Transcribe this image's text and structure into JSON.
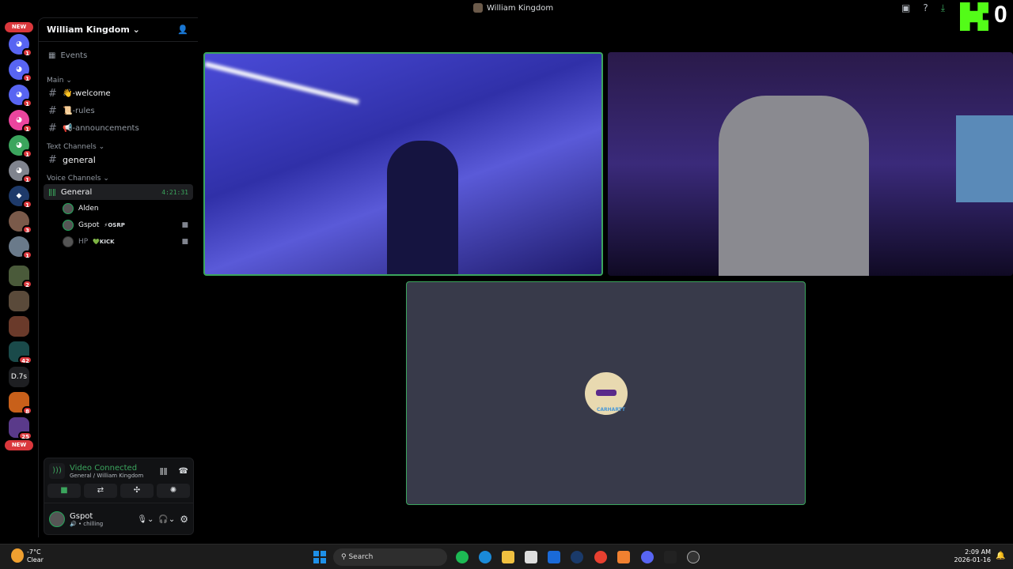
{
  "window": {
    "title": "William Kingdom"
  },
  "kick": {
    "count": "0",
    "color": "#53fc18"
  },
  "rail": {
    "new_top": "NEW",
    "new_bottom": "NEW",
    "dm_badges": [
      "1",
      "1",
      "1",
      "1",
      "1",
      "1",
      "1",
      "3",
      "1",
      "2"
    ],
    "badges_lower": [
      "42",
      "8",
      "25"
    ],
    "text_server": "D.7s"
  },
  "guild": {
    "name": "William Kingdom",
    "events": "Events",
    "categories": {
      "main": "Main",
      "text": "Text Channels",
      "voice": "Voice Channels"
    },
    "channels": {
      "welcome": "👋-welcome",
      "rules": "📜-rules",
      "announcements": "📢-announcements",
      "general": "general"
    },
    "voice_channel": {
      "name": "General",
      "duration": "4:21:31"
    },
    "voice_users": [
      {
        "name": "Alden",
        "tag": ""
      },
      {
        "name": "Gspot",
        "tag": "⚡OSRP"
      },
      {
        "name": "HP",
        "tag": "💚KICK"
      }
    ]
  },
  "connection": {
    "status": "Video Connected",
    "location": "General / William Kingdom",
    "accent": "#3ba55d"
  },
  "user": {
    "name": "Gspot",
    "status": "chilling"
  },
  "stage": {
    "tile3_label": "CARHARTT",
    "active_border": "#3ba55d"
  },
  "taskbar": {
    "weather_temp": "-7°C",
    "weather_desc": "Clear",
    "search": "Search",
    "time": "2:09 AM",
    "date": "2026-01-16"
  }
}
